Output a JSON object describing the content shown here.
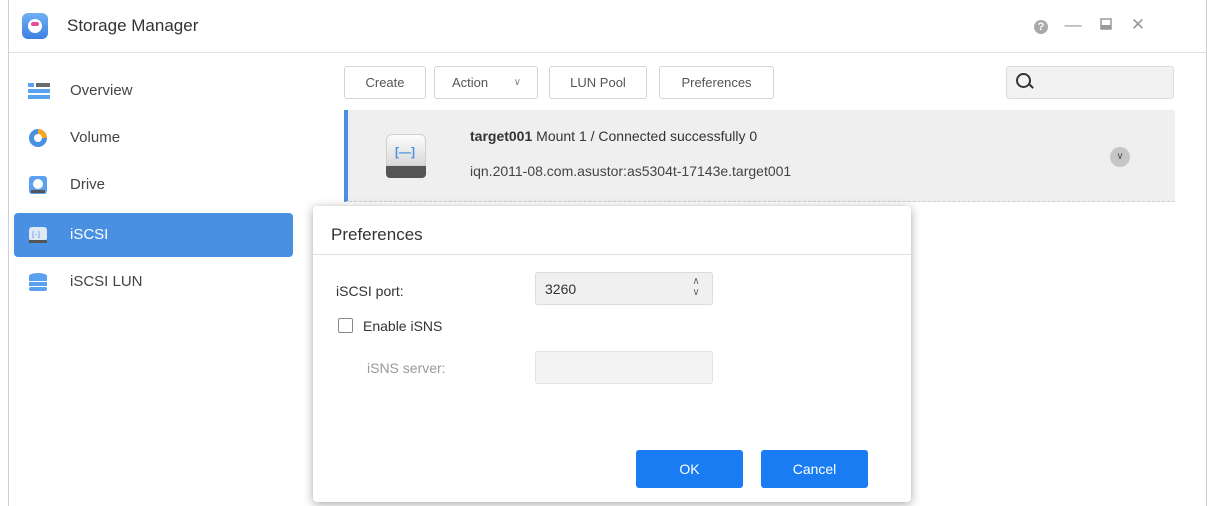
{
  "app": {
    "title": "Storage Manager"
  },
  "window_controls": [
    "help-icon",
    "minimize-icon",
    "maximize-icon",
    "close-icon"
  ],
  "sidebar": {
    "items": [
      {
        "label": "Overview",
        "icon": "overview-icon",
        "active": false
      },
      {
        "label": "Volume",
        "icon": "volume-icon",
        "active": false
      },
      {
        "label": "Drive",
        "icon": "drive-icon",
        "active": false
      },
      {
        "label": "iSCSI",
        "icon": "iscsi-icon",
        "active": true
      },
      {
        "label": "iSCSI LUN",
        "icon": "iscsi-lun-icon",
        "active": false
      }
    ]
  },
  "toolbar": {
    "create_label": "Create",
    "action_label": "Action",
    "lun_pool_label": "LUN Pool",
    "preferences_label": "Preferences",
    "search_value": ""
  },
  "target": {
    "name": "target001",
    "status": "Mount 1 / Connected successfully 0",
    "iqn": "iqn.2011-08.com.asustor:as5304t-17143e.target001"
  },
  "dialog": {
    "title": "Preferences",
    "port_label": "iSCSI port:",
    "port_value": "3260",
    "enable_isns_label": "Enable iSNS",
    "enable_isns_checked": false,
    "isns_server_label": "iSNS server:",
    "isns_server_value": "",
    "ok_label": "OK",
    "cancel_label": "Cancel"
  },
  "colors": {
    "accent": "#4a90e2",
    "primary_button": "#1a7cf2"
  }
}
